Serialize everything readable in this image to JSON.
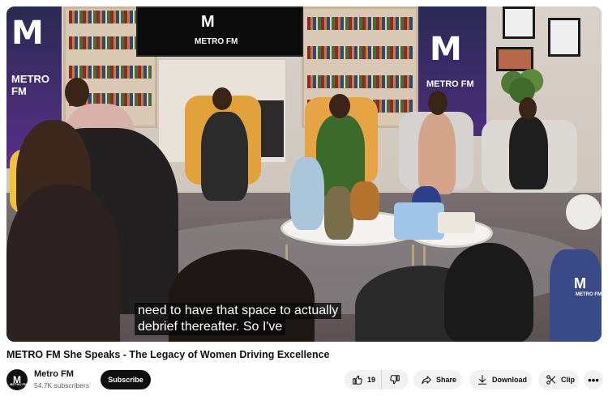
{
  "video": {
    "caption_line1": "need to have that space to actually",
    "caption_line2": "debrief thereafter. So I've",
    "set_logo_text": "M",
    "set_brand_text": "METRO FM",
    "tv_logo_text": "M",
    "tv_brand_text": "METRO FM",
    "watermark_logo": "M",
    "watermark_text": "METRO FM"
  },
  "title": "METRO FM She Speaks - The Legacy of Women Driving Excellence",
  "channel": {
    "avatar_text": "M",
    "avatar_subtext": "METRO FM",
    "name": "Metro FM",
    "subscribers": "54.7K subscribers",
    "subscribe_label": "Subscribe"
  },
  "actions": {
    "like_count": "19",
    "share_label": "Share",
    "download_label": "Download",
    "clip_label": "Clip",
    "more_label": "•••"
  },
  "icons": {
    "like": "thumbs-up-icon",
    "dislike": "thumbs-down-icon",
    "share": "share-arrow-icon",
    "download": "download-icon",
    "clip": "scissors-icon",
    "more": "more-horizontal-icon"
  },
  "colors": {
    "subscribe_bg": "#0f0f0f",
    "pill_bg": "#f2f2f2",
    "secondary_text": "#606060"
  }
}
